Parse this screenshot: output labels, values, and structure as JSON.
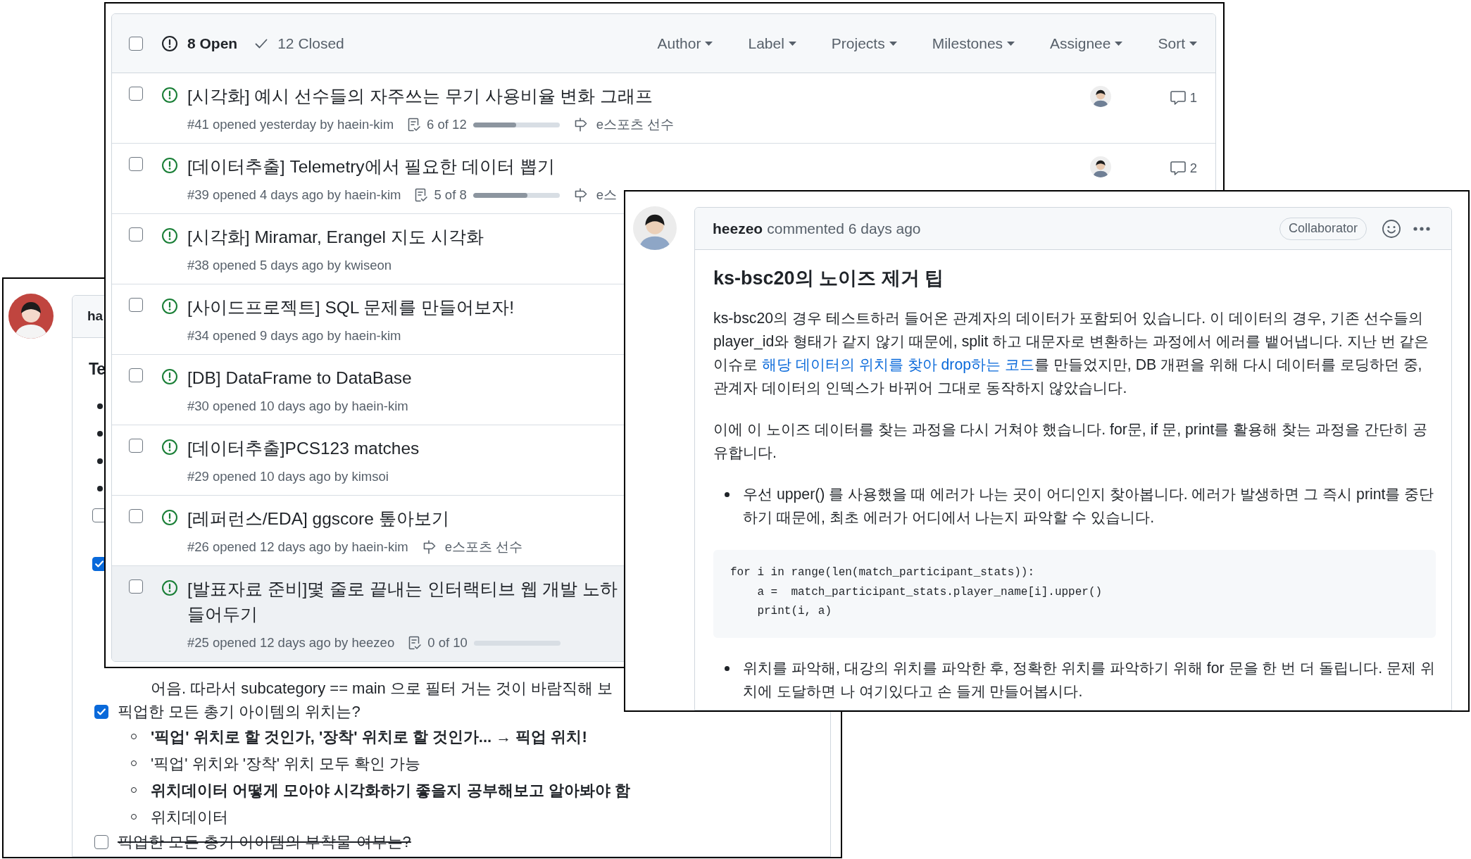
{
  "checklist_panel": {
    "author": "ha",
    "title": "Te",
    "covered_items": [
      {
        "kind": "bullet"
      },
      {
        "kind": "bullet"
      },
      {
        "kind": "bullet"
      },
      {
        "kind": "bullet"
      },
      {
        "kind": "checkbox",
        "checked": false
      },
      {
        "kind": "checkbox",
        "checked": true
      }
    ],
    "continued_line": "어음. 따라서 subcategory == main 으로 필터 거는 것이 바람직해 보",
    "tasks": [
      {
        "checked": true,
        "struck": false,
        "text": "픽업한 모든 총기 아이템의 위치는?",
        "children": [
          {
            "text": "'픽업' 위치로 할 것인가, '장착' 위치로 할 것인가... → 픽업 위치!",
            "bold": true
          },
          {
            "text": "'픽업' 위치와 '장착' 위치 모두 확인 가능",
            "bold": false
          },
          {
            "text": "위치데이터 어떻게 모아야 시각화하기 좋을지 공부해보고 알아봐야 함",
            "bold": true
          },
          {
            "text": "위치데이터",
            "bold": false
          }
        ]
      },
      {
        "checked": false,
        "struck": true,
        "text": "픽업한 모든 총기 아이템의 부착물 여부는?"
      }
    ]
  },
  "issue_list": {
    "select_all_checked": false,
    "tabs": [
      {
        "kind": "open",
        "label": "8 Open",
        "selected": true
      },
      {
        "kind": "closed",
        "label": "12 Closed",
        "selected": false
      }
    ],
    "filters": [
      "Author",
      "Label",
      "Projects",
      "Milestones",
      "Assignee",
      "Sort"
    ],
    "rows": [
      {
        "checked": false,
        "hovered": false,
        "title_lines": [
          "[시각화] 예시 선수들의 자주쓰는 무기 사용비율 변화 그래프"
        ],
        "meta": "#41 opened yesterday by haein-kim",
        "tasks": {
          "text": "6 of 12",
          "level": 0.5
        },
        "milestone": "e스포츠 선수",
        "avatar": true,
        "comments": "1"
      },
      {
        "checked": false,
        "hovered": false,
        "title_lines": [
          "[데이터추출] Telemetry에서 필요한 데이터 뽑기"
        ],
        "meta": "#39 opened 4 days ago by haein-kim",
        "tasks": {
          "text": "5 of 8",
          "level": 0.625
        },
        "milestone": "e스",
        "avatar": true,
        "comments": "2"
      },
      {
        "checked": false,
        "hovered": false,
        "title_lines": [
          "[시각화] Miramar, Erangel 지도 시각화"
        ],
        "meta": "#38 opened 5 days ago by kwiseon",
        "avatar": false
      },
      {
        "checked": false,
        "hovered": false,
        "title_lines": [
          "[사이드프로젝트] SQL 문제를 만들어보자!"
        ],
        "meta": "#34 opened 9 days ago by haein-kim",
        "avatar": false
      },
      {
        "checked": false,
        "hovered": false,
        "title_lines": [
          "[DB] DataFrame to DataBase"
        ],
        "meta": "#30 opened 10 days ago by haein-kim",
        "avatar": false
      },
      {
        "checked": false,
        "hovered": false,
        "title_lines": [
          "[데이터추출]PCS123 matches"
        ],
        "meta": "#29 opened 10 days ago by kimsoi",
        "avatar": false
      },
      {
        "checked": false,
        "hovered": false,
        "title_lines": [
          "[레퍼런스/EDA] ggscore 톺아보기"
        ],
        "meta": "#26 opened 12 days ago by haein-kim",
        "milestone": "e스포츠 선수",
        "avatar": false
      },
      {
        "checked": false,
        "hovered": true,
        "title_lines": [
          "[발표자료 준비]몇 줄로 끝내는 인터랙티브 웹 개발 노하",
          "들어두기"
        ],
        "meta": "#25 opened 12 days ago by heezeo",
        "tasks": {
          "text": "0 of 10",
          "level": 0
        },
        "avatar": false
      }
    ]
  },
  "comment_panel": {
    "author": "heezeo",
    "action": "commented 6 days ago",
    "badge": "Collaborator",
    "heading": "ks-bsc20의 노이즈 제거 팁",
    "blocks": [
      {
        "kind": "paragraph",
        "parts": [
          {
            "text": "ks-bsc20의 경우 테스트하러 들어온 관계자의 데이터가 포함되어 있습니다. 이 데이터의 경우, 기존 선수들의 player_id와 형태가 같지 않기 때문에, split 하고 대문자로 변환하는 과정에서 에러를 뱉어냅니다. 지난 번 같은 이슈로 ",
            "link": false
          },
          {
            "text": "해당 데이터의 위치를 찾아 drop하는 코드",
            "link": true
          },
          {
            "text": "를 만들었지만, DB 개편을 위해 다시 데이터를 로딩하던 중, 관계자 데이터의 인덱스가 바뀌어 그대로 동작하지 않았습니다.",
            "link": false
          }
        ]
      },
      {
        "kind": "paragraph",
        "parts": [
          {
            "text": "이에 이 노이즈 데이터를 찾는 과정을 다시 거쳐야 했습니다. for문, if 문, print를 활용해 찾는 과정을 간단히 공유합니다.",
            "link": false
          }
        ]
      },
      {
        "kind": "bullet",
        "text": "우선 upper() 를 사용했을 때 에러가 나는 곳이 어디인지 찾아봅니다. 에러가 발생하면 그 즉시 print를 중단하기 때문에, 최초 에러가 어디에서 나는지 파악할 수 있습니다."
      },
      {
        "kind": "code",
        "lines": [
          "for i in range(len(match_participant_stats)):",
          "    a =  match_participant_stats.player_name[i].upper()",
          "    print(i, a)"
        ]
      },
      {
        "kind": "bullet",
        "text": "위치를 파악해, 대강의 위치를 파악한 후, 정확한 위치를 파악하기 위해 for 문을 한 번 더 돌립니다. 문제 위치에 도달하면 나 여기있다고 손 들게 만들어봅시다."
      }
    ]
  }
}
